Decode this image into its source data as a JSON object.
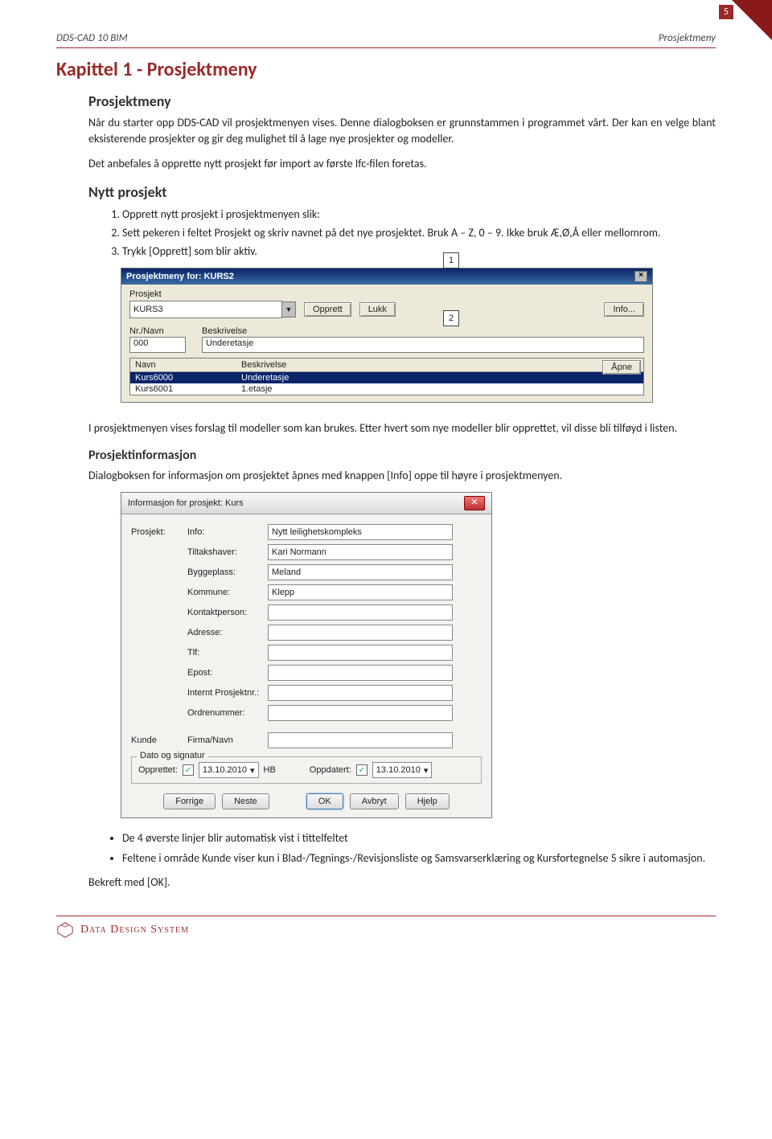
{
  "page_number": "5",
  "header": {
    "left": "DDS-CAD 10 BIM",
    "right": "Prosjektmeny"
  },
  "chapter_title": "Kapittel 1 - Prosjektmeny",
  "section1": {
    "title": "Prosjektmeny",
    "para1": "Når du starter opp DDS-CAD vil prosjektmenyen vises. Denne dialogboksen er grunnstammen i programmet vårt. Der kan en velge blant eksisterende prosjekter og gir deg mulighet til å lage nye prosjekter og modeller.",
    "para2": "Det anbefales å opprette nytt prosjekt før import av første Ifc-filen foretas."
  },
  "section2": {
    "title": "Nytt prosjekt",
    "items": [
      "Opprett nytt prosjekt i prosjektmenyen slik:",
      "Sett pekeren i feltet Prosjekt og skriv navnet på det nye prosjektet. Bruk A – Z, 0 – 9. Ikke bruk Æ,Ø,Å eller mellomrom.",
      "Trykk [Opprett] som blir aktiv."
    ]
  },
  "dialog1": {
    "title": "Prosjektmeny for: KURS2",
    "prosjekt_label": "Prosjekt",
    "prosjekt_value": "KURS3",
    "btn_opprett": "Opprett",
    "btn_lukk": "Lukk",
    "btn_info": "Info...",
    "nrnavn_label": "Nr./Navn",
    "nrnavn_value": "000",
    "beskriv_label": "Beskrivelse",
    "beskriv_value": "Underetasje",
    "list_head_navn": "Navn",
    "list_head_besk": "Beskrivelse",
    "rows": [
      {
        "navn": "Kurs6000",
        "besk": "Underetasje"
      },
      {
        "navn": "Kurs6001",
        "besk": "1.etasje"
      }
    ],
    "btn_apne": "Åpne",
    "callout1": "1",
    "callout2": "2"
  },
  "mid_para": "I prosjektmenyen vises forslag til modeller som kan brukes. Etter hvert som nye modeller blir opprettet, vil disse bli tilføyd i listen.",
  "section3": {
    "title": "Prosjektinformasjon",
    "para": "Dialogboksen for informasjon om prosjektet åpnes med knappen [Info] oppe til høyre i prosjektmenyen."
  },
  "dialog2": {
    "title": "Informasjon for prosjekt: Kurs",
    "section_prosjekt": "Prosjekt:",
    "fields": [
      {
        "label": "Info:",
        "value": "Nytt leilighetskompleks"
      },
      {
        "label": "Tiltakshaver:",
        "value": "Kari Normann"
      },
      {
        "label": "Byggeplass:",
        "value": "Meland"
      },
      {
        "label": "Kommune:",
        "value": "Klepp"
      },
      {
        "label": "Kontaktperson:",
        "value": ""
      },
      {
        "label": "Adresse:",
        "value": ""
      },
      {
        "label": "Tlf:",
        "value": ""
      },
      {
        "label": "Epost:",
        "value": ""
      },
      {
        "label": "Internt Prosjektnr.:",
        "value": ""
      },
      {
        "label": "Ordrenummer:",
        "value": ""
      }
    ],
    "section_kunde": "Kunde",
    "kunde_label": "Firma/Navn",
    "kunde_value": "",
    "group_title": "Dato og signatur",
    "opprettet_label": "Opprettet:",
    "oppdatert_label": "Oppdatert:",
    "date1": "13.10.2010",
    "sign": "HB",
    "date2": "13.10.2010",
    "btn_forrige": "Forrige",
    "btn_neste": "Neste",
    "btn_ok": "OK",
    "btn_avbryt": "Avbryt",
    "btn_hjelp": "Hjelp"
  },
  "bullets": [
    "De 4 øverste linjer blir automatisk vist i tittelfeltet",
    "Feltene i område Kunde viser kun i Blad-/Tegnings-/Revisjonsliste og Samsvarserklæring og Kursfortegnelse 5 sikre i automasjon."
  ],
  "closing": "Bekreft med [OK].",
  "footer": "Data Design System"
}
